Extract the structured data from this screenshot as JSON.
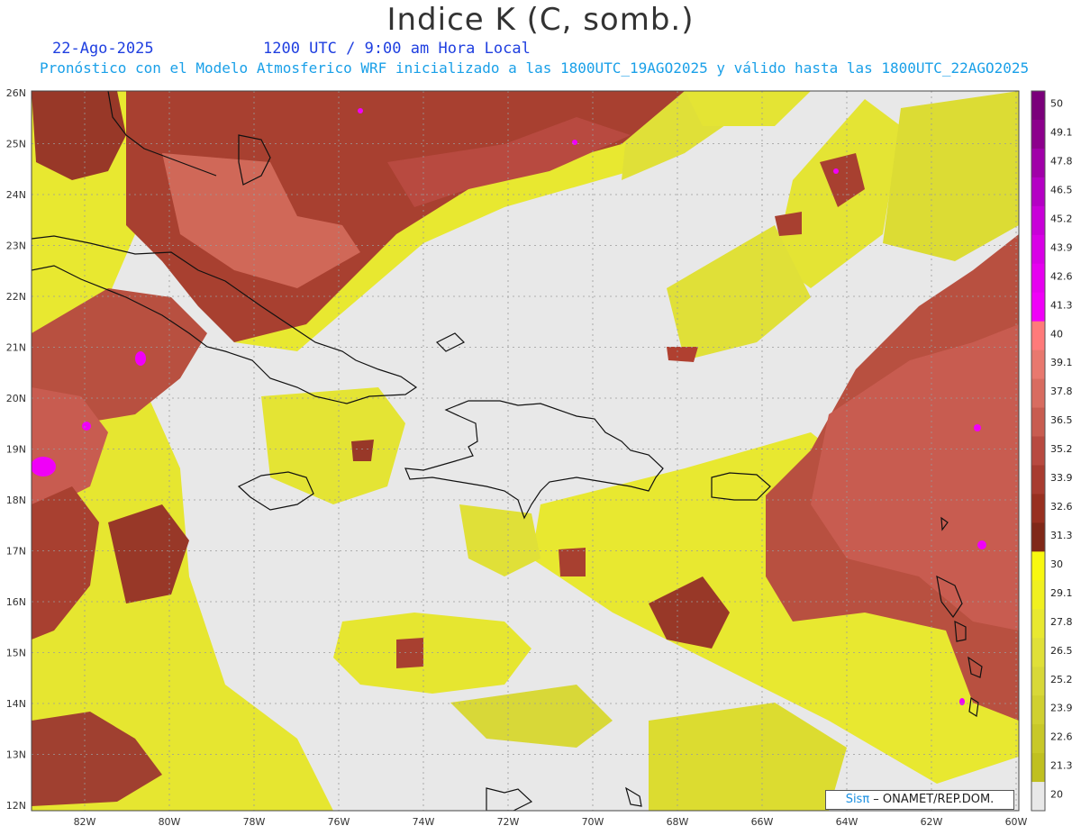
{
  "header": {
    "title": "Indice K (C, somb.)",
    "date": "22-Ago-2025",
    "time": "1200 UTC / 9:00 am Hora Local",
    "forecast": "Pronóstico con el Modelo Atmosferico WRF inicializado a las 1800UTC_19AGO2025 y válido hasta las  1800UTC_22AGO2025"
  },
  "axes": {
    "lon_labels": [
      "82W",
      "80W",
      "78W",
      "76W",
      "74W",
      "72W",
      "70W",
      "68W",
      "66W",
      "64W",
      "62W",
      "60W"
    ],
    "lat_labels": [
      "26N",
      "25N",
      "24N",
      "23N",
      "22N",
      "21N",
      "20N",
      "19N",
      "18N",
      "17N",
      "16N",
      "15N",
      "14N",
      "13N",
      "12N"
    ]
  },
  "colorbar": {
    "labels": [
      "50",
      "49.1",
      "47.8",
      "46.5",
      "45.2",
      "43.9",
      "42.6",
      "41.3",
      "40",
      "39.1",
      "37.8",
      "36.5",
      "35.2",
      "33.9",
      "32.6",
      "31.3",
      "30",
      "29.1",
      "27.8",
      "26.5",
      "25.2",
      "23.9",
      "22.6",
      "21.3",
      "20"
    ],
    "colors": [
      "#7a007a",
      "#8c008c",
      "#a000a8",
      "#b400c4",
      "#c800d8",
      "#d800e6",
      "#e600f0",
      "#f000f8",
      "#ff7a7a",
      "#e8786e",
      "#d86c60",
      "#c85c50",
      "#b84a40",
      "#a83c30",
      "#983020",
      "#802818",
      "#f8f810",
      "#f0f020",
      "#e8e830",
      "#e0e038",
      "#d8d838",
      "#d0d030",
      "#c8c828",
      "#c0c020",
      "#e8e8e8"
    ]
  },
  "credit": {
    "brand": "Sisπ",
    "text": " –  ONAMET/REP.DOM."
  }
}
